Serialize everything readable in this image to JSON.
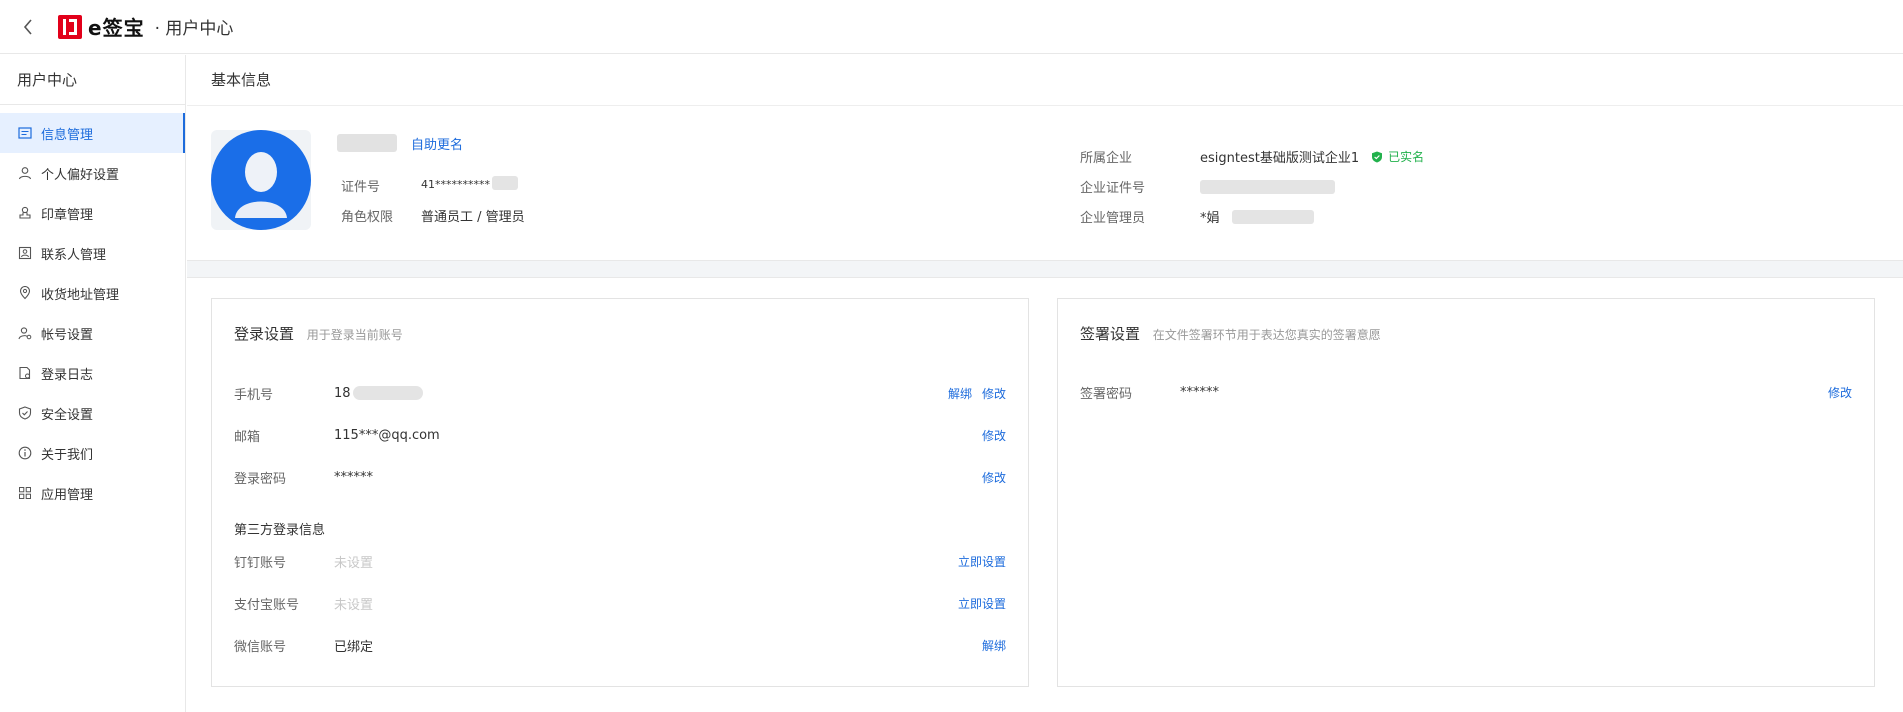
{
  "header": {
    "brand": "e签宝",
    "separator": "·",
    "title": "用户中心"
  },
  "sidebar": {
    "title": "用户中心",
    "items": [
      {
        "label": "信息管理",
        "icon": "id-card-icon",
        "active": true
      },
      {
        "label": "个人偏好设置",
        "icon": "user-icon"
      },
      {
        "label": "印章管理",
        "icon": "seal-icon"
      },
      {
        "label": "联系人管理",
        "icon": "contact-icon"
      },
      {
        "label": "收货地址管理",
        "icon": "location-icon"
      },
      {
        "label": "帐号设置",
        "icon": "user-settings-icon"
      },
      {
        "label": "登录日志",
        "icon": "log-icon"
      },
      {
        "label": "安全设置",
        "icon": "shield-icon"
      },
      {
        "label": "关于我们",
        "icon": "info-icon"
      },
      {
        "label": "应用管理",
        "icon": "apps-icon"
      }
    ]
  },
  "basic": {
    "title": "基本信息",
    "rename_link": "自助更名",
    "id_label": "证件号",
    "id_value": "41**********",
    "role_label": "角色权限",
    "role_value": "普通员工 / 管理员",
    "company_label": "所属企业",
    "company_value": "esigntest基础版测试企业1",
    "verified_label": "已实名",
    "company_id_label": "企业证件号",
    "company_admin_label": "企业管理员",
    "company_admin_value": "*娟"
  },
  "login": {
    "title": "登录设置",
    "subtitle": "用于登录当前账号",
    "phone_label": "手机号",
    "phone_value": "18",
    "unbind": "解绑",
    "modify": "修改",
    "email_label": "邮箱",
    "email_value": "115***@qq.com",
    "password_label": "登录密码",
    "password_value": "******",
    "third_party_title": "第三方登录信息",
    "dingtalk_label": "钉钉账号",
    "alipay_label": "支付宝账号",
    "wechat_label": "微信账号",
    "not_set": "未设置",
    "set_now": "立即设置",
    "bound": "已绑定"
  },
  "sign": {
    "title": "签署设置",
    "subtitle": "在文件签署环节用于表达您真实的签署意愿",
    "password_label": "签署密码",
    "password_value": "******",
    "modify": "修改"
  },
  "colors": {
    "accent": "#1c6bdc",
    "brand_red": "#e2001a",
    "verified_green": "#22b14c"
  }
}
